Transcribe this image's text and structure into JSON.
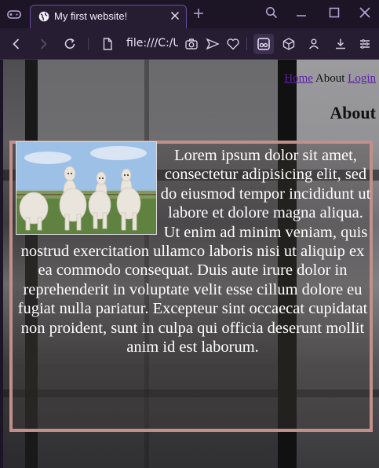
{
  "browser": {
    "tab_title": "My first website!",
    "url": "file:///C:/Us",
    "icons": [
      "gamepad-icon",
      "globe-icon",
      "close-icon",
      "plus-icon",
      "search-icon",
      "minimize-icon",
      "maximize-icon",
      "close-window-icon",
      "back-icon",
      "forward-icon",
      "reload-icon",
      "file-icon",
      "camera-icon",
      "send-icon",
      "heart-icon",
      "reader-icon",
      "cube-icon",
      "profile-icon",
      "download-icon",
      "menu-icon"
    ]
  },
  "nav": {
    "home": "Home",
    "about": "About",
    "login": "Login"
  },
  "page": {
    "heading": "About",
    "paragraph": "Lorem ipsum dolor sit amet, consectetur adipisicing elit, sed do eiusmod tempor incididunt ut labore et dolore magna aliqua. Ut enim ad minim veniam, quis nostrud exercitation ullamco laboris nisi ut aliquip ex ea commodo consequat. Duis aute irure dolor in reprehenderit in voluptate velit esse cillum dolore eu fugiat nulla pariatur. Excepteur sint occaecat cupidatat non proident, sunt in culpa qui officia deserunt mollit anim id est laborum."
  },
  "colors": {
    "chrome_bg": "#1c1526",
    "toolbar_bg": "#261d33",
    "accent": "#6b4ea0",
    "link": "#5b1fa8",
    "box_border": "#c2908a"
  }
}
